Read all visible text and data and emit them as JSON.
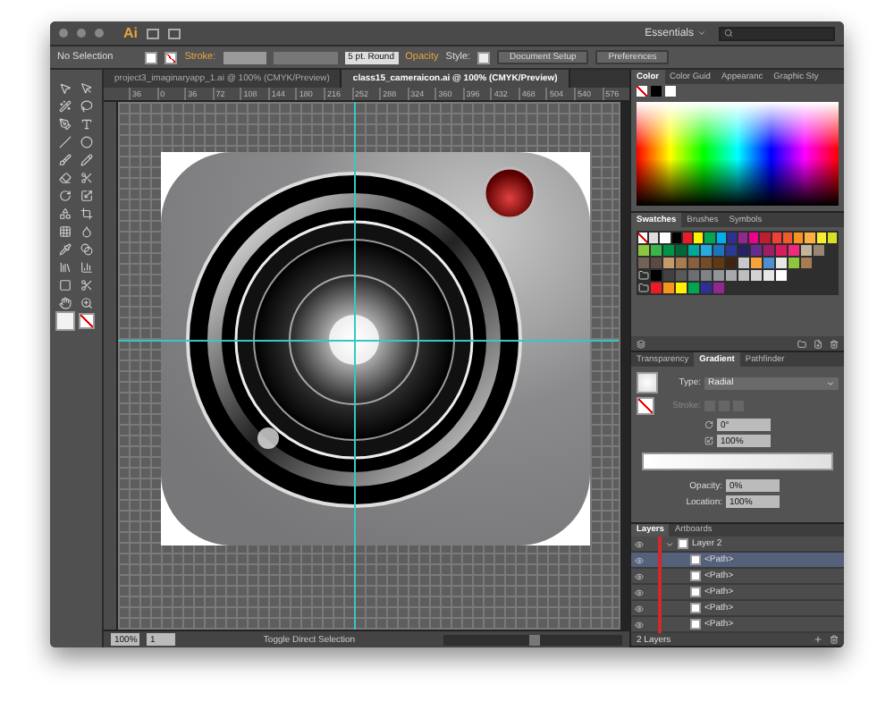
{
  "title_bar": {
    "app_logo": "Ai",
    "workspace": "Essentials"
  },
  "control_bar": {
    "selection": "No Selection",
    "stroke_label": "Stroke:",
    "brush": "5 pt. Round",
    "opacity_label": "Opacity",
    "style_label": "Style:",
    "buttons": [
      "Document Setup",
      "Preferences"
    ]
  },
  "document_tabs": [
    {
      "label": "project3_imaginaryapp_1.ai @ 100% (CMYK/Preview)",
      "selected": false
    },
    {
      "label": "class15_cameraicon.ai @ 100% (CMYK/Preview)",
      "selected": true
    }
  ],
  "ruler": {
    "labels": [
      "36",
      "0",
      "36",
      "72",
      "108",
      "144",
      "180",
      "216",
      "252",
      "288",
      "324",
      "360",
      "396",
      "432",
      "468",
      "504",
      "540",
      "576"
    ]
  },
  "status_bar": {
    "zoom": "100%",
    "page": "1",
    "message": "Toggle Direct Selection"
  },
  "color_panel": {
    "tabs": [
      {
        "label": "Color",
        "selected": true
      },
      {
        "label": "Color Guid",
        "selected": false
      },
      {
        "label": "Appearanc",
        "selected": false
      },
      {
        "label": "Graphic Sty",
        "selected": false
      }
    ]
  },
  "swatches_panel": {
    "tabs": [
      {
        "label": "Swatches",
        "selected": true
      },
      {
        "label": "Brushes",
        "selected": false
      },
      {
        "label": "Symbols",
        "selected": false
      }
    ],
    "rows": [
      {
        "folder": false,
        "colors": [
          {
            "color": "#ffffff"
          },
          {
            "color": "#000000"
          },
          {
            "color": "#ed1c24"
          },
          {
            "color": "#fff200"
          },
          {
            "color": "#00a651"
          },
          {
            "color": "#00aeef"
          },
          {
            "color": "#2e3192"
          },
          {
            "color": "#92278f"
          },
          {
            "color": "#ec008c"
          },
          {
            "color": "#be1e2d"
          },
          {
            "color": "#ef4136"
          },
          {
            "color": "#f15a29"
          },
          {
            "color": "#f7941d"
          },
          {
            "color": "#fbb040"
          },
          {
            "color": "#f9ed32"
          },
          {
            "color": "#d7df23"
          }
        ]
      },
      {
        "folder": false,
        "colors": [
          {
            "color": "#8dc63f"
          },
          {
            "color": "#39b54a"
          },
          {
            "color": "#009444"
          },
          {
            "color": "#006838"
          },
          {
            "color": "#00a79d"
          },
          {
            "color": "#27aae1"
          },
          {
            "color": "#1c75bc"
          },
          {
            "color": "#2b3990"
          },
          {
            "color": "#262262"
          },
          {
            "color": "#662d91"
          },
          {
            "color": "#9e1f63"
          },
          {
            "color": "#da1c5c"
          },
          {
            "color": "#ee2a7b"
          },
          {
            "color": "#c2b59b"
          },
          {
            "color": "#998675"
          }
        ]
      },
      {
        "folder": false,
        "colors": [
          {
            "color": "#736357"
          },
          {
            "color": "#594a42"
          },
          {
            "color": "#c49a6c"
          },
          {
            "color": "#a97c50"
          },
          {
            "color": "#8b5e3c"
          },
          {
            "color": "#754c29"
          },
          {
            "color": "#603913"
          },
          {
            "color": "#3c2415"
          },
          {
            "color": "#c7c8ca"
          },
          {
            "color": "#f9a13a"
          },
          {
            "color": "#4f8fcf"
          },
          {
            "color": "#e8e8e8"
          },
          {
            "color": "#8cc63f"
          },
          {
            "color": "#a67c52"
          }
        ]
      },
      {
        "folder": true,
        "colors": [
          {
            "color": "#000000"
          },
          {
            "color": "#414042"
          },
          {
            "color": "#58595b"
          },
          {
            "color": "#6d6e71"
          },
          {
            "color": "#808285"
          },
          {
            "color": "#939598"
          },
          {
            "color": "#a7a9ac"
          },
          {
            "color": "#bcbec0"
          },
          {
            "color": "#d1d3d4"
          },
          {
            "color": "#e6e7e8"
          },
          {
            "color": "#ffffff"
          }
        ]
      },
      {
        "folder": true,
        "colors": [
          {
            "color": "#ed1c24"
          },
          {
            "color": "#f7941d"
          },
          {
            "color": "#fff200"
          },
          {
            "color": "#00a651"
          },
          {
            "color": "#2e3192"
          },
          {
            "color": "#92278f"
          }
        ]
      }
    ]
  },
  "gradient_panel": {
    "tabs": [
      {
        "label": "Transparency",
        "selected": false
      },
      {
        "label": "Gradient",
        "selected": true
      },
      {
        "label": "Pathfinder",
        "selected": false
      }
    ],
    "type_label": "Type:",
    "type": "Radial",
    "stroke_label": "Stroke:",
    "angle": "0°",
    "aspect": "100%",
    "opacity_label": "Opacity:",
    "opacity": "0%",
    "location_label": "Location:",
    "location": "100%"
  },
  "layers_panel": {
    "tabs": [
      {
        "label": "Layers",
        "selected": true
      },
      {
        "label": "Artboards",
        "selected": false
      }
    ],
    "layers": [
      {
        "name": "Layer 2",
        "expanded": true,
        "children": [
          {
            "name": "<Path>",
            "selected": true
          },
          {
            "name": "<Path>",
            "selected": false
          },
          {
            "name": "<Path>",
            "selected": false
          },
          {
            "name": "<Path>",
            "selected": false
          },
          {
            "name": "<Path>",
            "selected": false
          }
        ]
      }
    ],
    "count": "2 Layers"
  }
}
